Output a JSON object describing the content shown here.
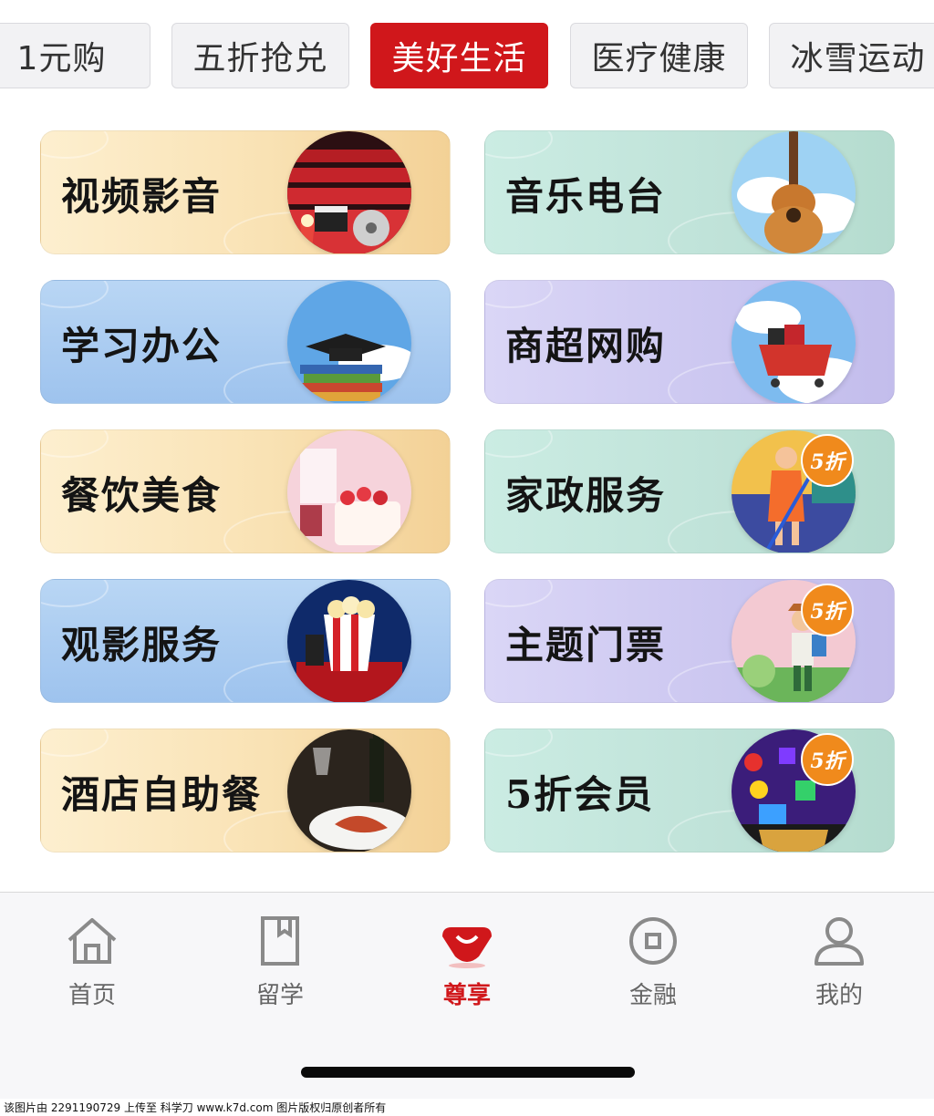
{
  "tabs": [
    {
      "label": "1元购",
      "active": false
    },
    {
      "label": "五折抢兑",
      "active": false
    },
    {
      "label": "美好生活",
      "active": true
    },
    {
      "label": "医疗健康",
      "active": false
    },
    {
      "label": "冰雪运动",
      "active": false
    }
  ],
  "cards": [
    {
      "label": "视频影音",
      "theme": "gold",
      "icon": "cinema-image"
    },
    {
      "label": "音乐电台",
      "theme": "mint",
      "icon": "guitar-image"
    },
    {
      "label": "学习办公",
      "theme": "blue",
      "icon": "graduation-books-image"
    },
    {
      "label": "商超网购",
      "theme": "lav",
      "icon": "shopping-cart-image"
    },
    {
      "label": "餐饮美食",
      "theme": "gold",
      "icon": "cake-wine-image"
    },
    {
      "label": "家政服务",
      "theme": "mint",
      "icon": "housekeeping-image",
      "badge": "5折"
    },
    {
      "label": "观影服务",
      "theme": "blue",
      "icon": "popcorn-image"
    },
    {
      "label": "主题门票",
      "theme": "lav",
      "icon": "tourist-image",
      "badge": "5折"
    },
    {
      "label": "酒店自助餐",
      "theme": "gold",
      "icon": "buffet-image"
    },
    {
      "label": "5折会员",
      "theme": "mint",
      "icon": "membership-apps-image",
      "badge": "5折"
    }
  ],
  "nav": [
    {
      "label": "首页",
      "icon": "home-icon",
      "active": false
    },
    {
      "label": "留学",
      "icon": "book-icon",
      "active": false
    },
    {
      "label": "尊享",
      "icon": "shopping-bag-icon",
      "active": true
    },
    {
      "label": "金融",
      "icon": "coin-icon",
      "active": false
    },
    {
      "label": "我的",
      "icon": "user-icon",
      "active": false
    }
  ],
  "colors": {
    "accent": "#d0171b",
    "nav_inactive": "#8a8a8a"
  },
  "watermark": "该图片由 2291190729 上传至 科学刀 www.k7d.com 图片版权归原创者所有"
}
